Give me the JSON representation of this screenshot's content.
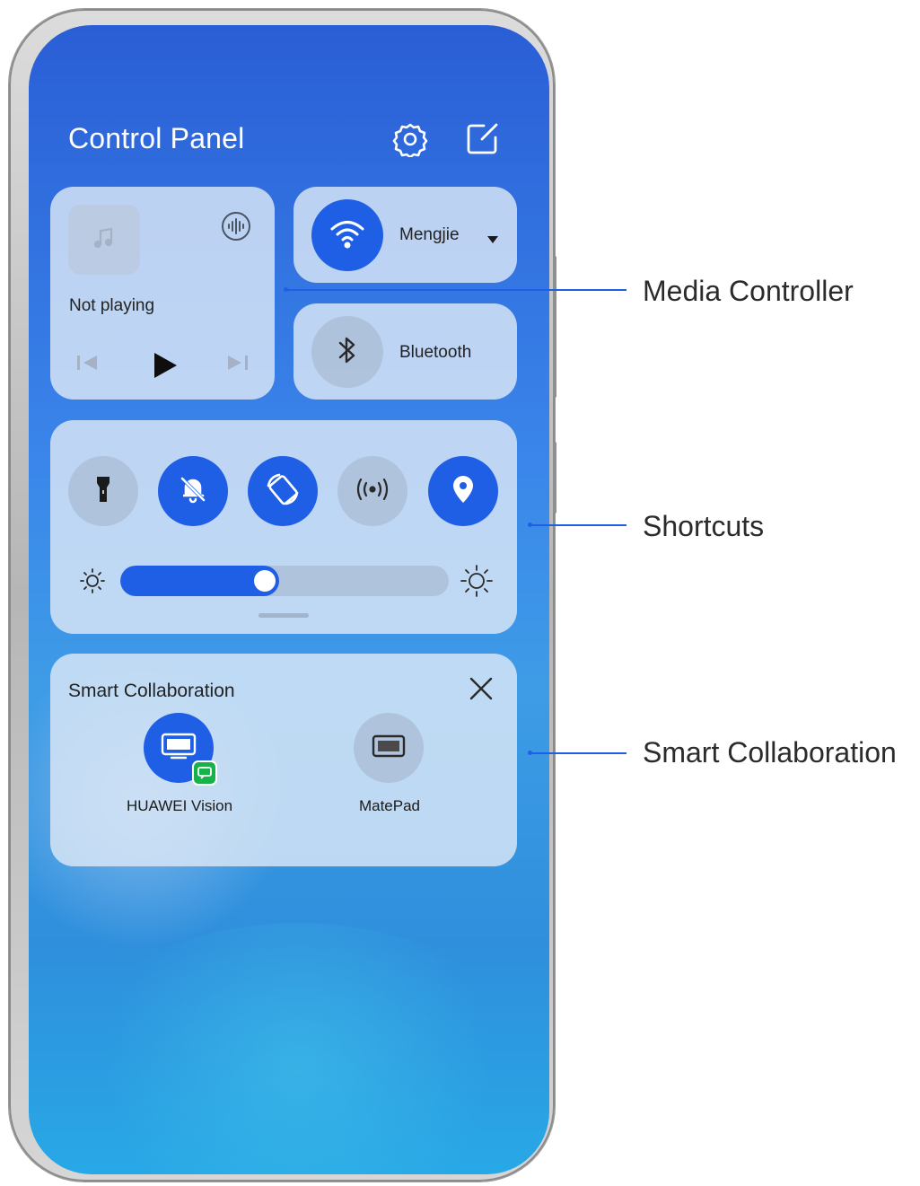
{
  "panel": {
    "title": "Control Panel",
    "settings_icon": "gear-icon",
    "edit_icon": "edit-icon"
  },
  "media": {
    "status": "Not playing",
    "album_icon": "music-note-icon",
    "audio_output_icon": "audio-output-icon",
    "controls": [
      "previous-icon",
      "play-icon",
      "next-icon"
    ]
  },
  "wifi": {
    "label": "Mengjie",
    "state": "on"
  },
  "bluetooth": {
    "label": "Bluetooth",
    "state": "off"
  },
  "shortcuts": {
    "toggles": [
      {
        "name": "flashlight",
        "icon": "flashlight-icon",
        "state": "off"
      },
      {
        "name": "silent",
        "icon": "bell-off-icon",
        "state": "on"
      },
      {
        "name": "auto-rotate",
        "icon": "auto-rotate-icon",
        "state": "on"
      },
      {
        "name": "hotspot",
        "icon": "hotspot-icon",
        "state": "off"
      },
      {
        "name": "location",
        "icon": "location-icon",
        "state": "on"
      }
    ],
    "brightness": 0.44
  },
  "collaboration": {
    "title": "Smart Collaboration",
    "devices": [
      {
        "label": "HUAWEI Vision",
        "icon": "tv-icon",
        "state": "connected"
      },
      {
        "label": "MatePad",
        "icon": "tablet-icon",
        "state": "available"
      }
    ]
  },
  "callouts": {
    "media": "Media Controller",
    "shortcuts": "Shortcuts",
    "collaboration": "Smart Collaboration"
  },
  "colors": {
    "accent": "#1f5fe6",
    "screen_top": "#2a5ed6",
    "screen_bottom": "#28a8e6"
  }
}
